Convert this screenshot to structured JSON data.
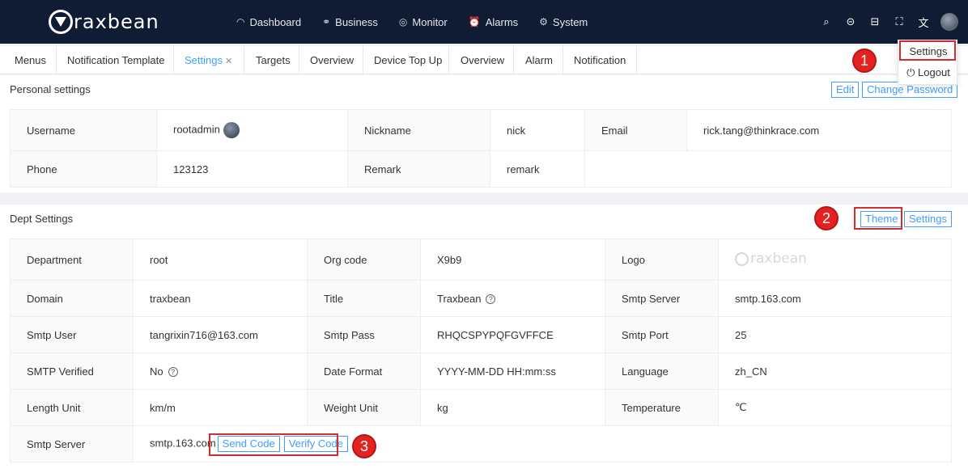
{
  "header": {
    "logo_text": "raxbean",
    "nav": [
      {
        "icon": "◠",
        "label": "Dashboard"
      },
      {
        "icon": "⚭",
        "label": "Business"
      },
      {
        "icon": "◎",
        "label": "Monitor"
      },
      {
        "icon": "⏰",
        "label": "Alarms"
      },
      {
        "icon": "⚙",
        "label": "System"
      }
    ],
    "right_icons": {
      "search": "⌕",
      "chat": "⊝",
      "lock": "⊟",
      "fullscreen": "⛶",
      "translate": "⽂"
    }
  },
  "tabs": [
    {
      "label": "Menus"
    },
    {
      "label": "Notification Template"
    },
    {
      "label": "Settings",
      "close": "✕"
    },
    {
      "label": "Targets"
    },
    {
      "label": "Overview"
    },
    {
      "label": "Device Top Up"
    },
    {
      "label": "Overview"
    },
    {
      "label": "Alarm"
    },
    {
      "label": "Notification"
    }
  ],
  "dropdown": {
    "settings": "Settings",
    "logout": "⏻ Logout"
  },
  "annotations": {
    "one": "1",
    "two": "2",
    "three": "3"
  },
  "personal": {
    "title": "Personal settings",
    "edit_label": "Edit",
    "change_password_label": "Change Password",
    "rows": [
      {
        "l1": "Username",
        "v1": "rootadmin",
        "l2": "Nickname",
        "v2": "nick",
        "l3": "Email",
        "v3": "rick.tang@thinkrace.com"
      },
      {
        "l1": "Phone",
        "v1": "123123",
        "l2": "Remark",
        "v2": "remark"
      }
    ]
  },
  "dept": {
    "title": "Dept Settings",
    "theme_label": "Theme",
    "settings_label": "Settings",
    "logo_text": "raxbean",
    "help_icon": "?",
    "rows": [
      {
        "l1": "Department",
        "v1": "root",
        "l2": "Org code",
        "v2": "X9b9",
        "l3": "Logo"
      },
      {
        "l1": "Domain",
        "v1": "traxbean",
        "l2": "Title",
        "v2": "Traxbean",
        "l3": "Smtp Server",
        "v3": "smtp.163.com"
      },
      {
        "l1": "Smtp User",
        "v1": "tangrixin716@163.com",
        "l2": "Smtp Pass",
        "v2": "RHQCSPYPQFGVFFCE",
        "l3": "Smtp Port",
        "v3": "25"
      },
      {
        "l1": "SMTP Verified",
        "v1": "No",
        "l2": "Date Format",
        "v2": "YYYY-MM-DD HH:mm:ss",
        "l3": "Language",
        "v3": "zh_CN"
      },
      {
        "l1": "Length Unit",
        "v1": "km/m",
        "l2": "Weight Unit",
        "v2": "kg",
        "l3": "Temperature",
        "v3": "℃"
      },
      {
        "l1": "Smtp Server",
        "v1": "smtp.163.com"
      }
    ],
    "send_code_label": "Send Code",
    "verify_code_label": "Verify Code"
  },
  "colors": {
    "topbar": "#101c33",
    "accent": "#409eff",
    "annotation_red": "#e42222"
  }
}
